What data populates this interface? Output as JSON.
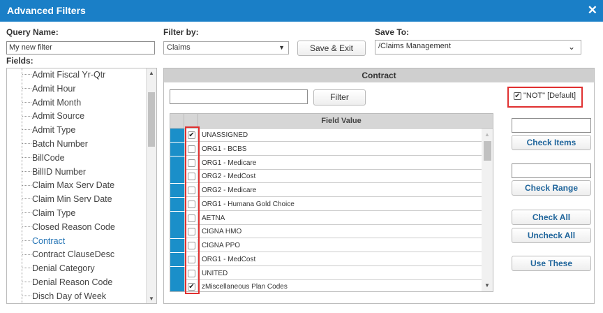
{
  "dialog": {
    "title": "Advanced Filters",
    "close_glyph": "✕"
  },
  "query_name": {
    "label": "Query Name:",
    "value": "My new filter"
  },
  "filter_by": {
    "label": "Filter by:",
    "selected": "Claims",
    "arrow": "▼"
  },
  "save_exit": {
    "label": "Save & Exit"
  },
  "save_to": {
    "label": "Save To:",
    "selected": "/Claims Management",
    "arrow": "⌄"
  },
  "fields": {
    "label": "Fields:",
    "items": [
      {
        "label": "Admit Fiscal Yr-Qtr",
        "selected": false
      },
      {
        "label": "Admit Hour",
        "selected": false
      },
      {
        "label": "Admit Month",
        "selected": false
      },
      {
        "label": "Admit Source",
        "selected": false
      },
      {
        "label": "Admit Type",
        "selected": false
      },
      {
        "label": "Batch Number",
        "selected": false
      },
      {
        "label": "BillCode",
        "selected": false
      },
      {
        "label": "BillID Number",
        "selected": false
      },
      {
        "label": "Claim Max Serv Date",
        "selected": false
      },
      {
        "label": "Claim Min Serv Date",
        "selected": false
      },
      {
        "label": "Claim Type",
        "selected": false
      },
      {
        "label": "Closed Reason Code",
        "selected": false
      },
      {
        "label": "Contract",
        "selected": true
      },
      {
        "label": "Contract ClauseDesc",
        "selected": false
      },
      {
        "label": "Denial Category",
        "selected": false
      },
      {
        "label": "Denial Reason Code",
        "selected": false
      },
      {
        "label": "Disch Day of Week",
        "selected": false
      }
    ],
    "scroll_up": "▲",
    "scroll_down": "▼"
  },
  "panel": {
    "title": "Contract",
    "search_value": "",
    "filter_button": "Filter",
    "not_default": {
      "label": "\"NOT\" [Default]",
      "checked": true
    },
    "grid": {
      "header": "Field Value",
      "scroll_up": "▲",
      "scroll_down": "▼",
      "rows": [
        {
          "value": "UNASSIGNED",
          "checked": true
        },
        {
          "value": "ORG1 - BCBS",
          "checked": false
        },
        {
          "value": "ORG1 - Medicare",
          "checked": false
        },
        {
          "value": "ORG2 - MedCost",
          "checked": false
        },
        {
          "value": "ORG2 - Medicare",
          "checked": false
        },
        {
          "value": "ORG1 - Humana Gold Choice",
          "checked": false
        },
        {
          "value": "AETNA",
          "checked": false
        },
        {
          "value": "CIGNA HMO",
          "checked": false
        },
        {
          "value": "CIGNA PPO",
          "checked": false
        },
        {
          "value": "ORG1 - MedCost",
          "checked": false
        },
        {
          "value": "UNITED",
          "checked": false
        },
        {
          "value": "zMiscellaneous Plan Codes",
          "checked": true
        }
      ]
    },
    "check_items": {
      "input_value": "",
      "button": "Check Items"
    },
    "check_range": {
      "input_value": "",
      "button": "Check Range"
    },
    "check_all": "Check All",
    "uncheck_all": "Uncheck All",
    "use_these": "Use These"
  },
  "colors": {
    "title_bar": "#1a7fc7",
    "row_marker": "#1a8fc9",
    "highlight_box": "#e03030",
    "link_blue": "#2474b5"
  }
}
